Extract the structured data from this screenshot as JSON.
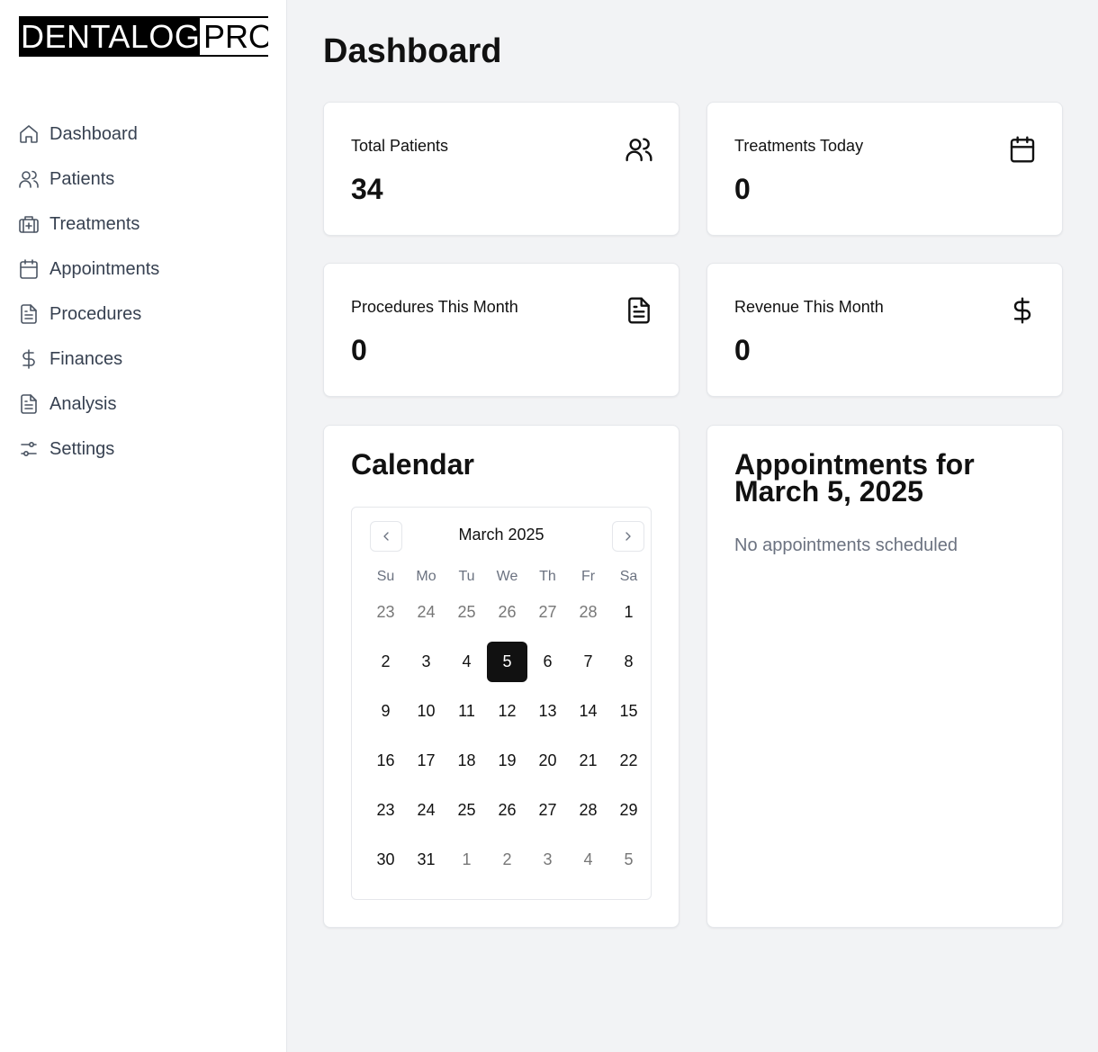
{
  "brand": {
    "main": "DENTALOG",
    "suffix": "PRO"
  },
  "nav": [
    {
      "label": "Dashboard",
      "icon": "home-icon"
    },
    {
      "label": "Patients",
      "icon": "users-icon"
    },
    {
      "label": "Treatments",
      "icon": "briefcase-medical-icon"
    },
    {
      "label": "Appointments",
      "icon": "calendar-icon"
    },
    {
      "label": "Procedures",
      "icon": "file-text-icon"
    },
    {
      "label": "Finances",
      "icon": "dollar-icon"
    },
    {
      "label": "Analysis",
      "icon": "file-text-icon"
    },
    {
      "label": "Settings",
      "icon": "sliders-icon"
    }
  ],
  "page": {
    "title": "Dashboard"
  },
  "stats": {
    "total_patients": {
      "label": "Total Patients",
      "value": "34",
      "icon": "users-icon"
    },
    "treatments_today": {
      "label": "Treatments Today",
      "value": "0",
      "icon": "calendar-icon"
    },
    "procedures_month": {
      "label": "Procedures This Month",
      "value": "0",
      "icon": "file-text-icon"
    },
    "revenue_month": {
      "label": "Revenue This Month",
      "value": "0",
      "icon": "dollar-icon"
    }
  },
  "calendar": {
    "title": "Calendar",
    "month_label": "March 2025",
    "weekdays": [
      "Su",
      "Mo",
      "Tu",
      "We",
      "Th",
      "Fr",
      "Sa"
    ],
    "weeks": [
      [
        {
          "d": "23",
          "out": true
        },
        {
          "d": "24",
          "out": true
        },
        {
          "d": "25",
          "out": true
        },
        {
          "d": "26",
          "out": true
        },
        {
          "d": "27",
          "out": true
        },
        {
          "d": "28",
          "out": true
        },
        {
          "d": "1"
        }
      ],
      [
        {
          "d": "2"
        },
        {
          "d": "3"
        },
        {
          "d": "4"
        },
        {
          "d": "5",
          "sel": true
        },
        {
          "d": "6"
        },
        {
          "d": "7"
        },
        {
          "d": "8"
        }
      ],
      [
        {
          "d": "9"
        },
        {
          "d": "10"
        },
        {
          "d": "11"
        },
        {
          "d": "12"
        },
        {
          "d": "13"
        },
        {
          "d": "14"
        },
        {
          "d": "15"
        }
      ],
      [
        {
          "d": "16"
        },
        {
          "d": "17"
        },
        {
          "d": "18"
        },
        {
          "d": "19"
        },
        {
          "d": "20"
        },
        {
          "d": "21"
        },
        {
          "d": "22"
        }
      ],
      [
        {
          "d": "23"
        },
        {
          "d": "24"
        },
        {
          "d": "25"
        },
        {
          "d": "26"
        },
        {
          "d": "27"
        },
        {
          "d": "28"
        },
        {
          "d": "29"
        }
      ],
      [
        {
          "d": "30"
        },
        {
          "d": "31"
        },
        {
          "d": "1",
          "out": true
        },
        {
          "d": "2",
          "out": true
        },
        {
          "d": "3",
          "out": true
        },
        {
          "d": "4",
          "out": true
        },
        {
          "d": "5",
          "out": true
        }
      ]
    ]
  },
  "appointments": {
    "title": "Appointments for March 5, 2025",
    "empty_text": "No appointments scheduled"
  }
}
